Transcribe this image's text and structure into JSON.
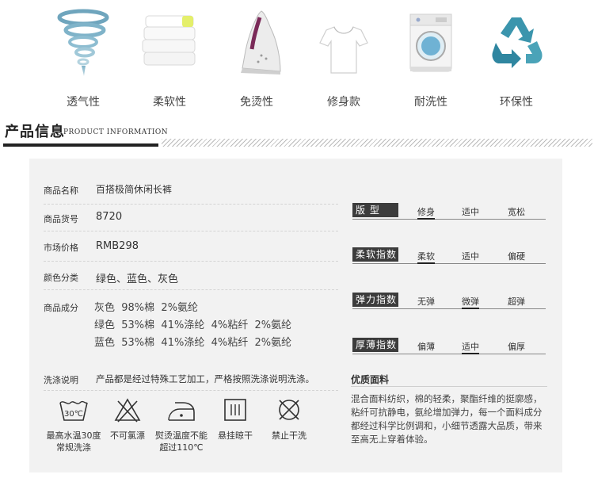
{
  "features": [
    {
      "icon": "tornado-icon",
      "label": "透气性"
    },
    {
      "icon": "folded-towels-icon",
      "label": "柔软性"
    },
    {
      "icon": "iron-icon",
      "label": "免烫性"
    },
    {
      "icon": "tshirt-icon",
      "label": "修身款"
    },
    {
      "icon": "washing-machine-icon",
      "label": "耐洗性"
    },
    {
      "icon": "recycle-icon",
      "label": "环保性"
    }
  ],
  "section": {
    "title": "产品信息",
    "subtitle": "PRODUCT INFORMATION"
  },
  "info": {
    "name": {
      "key": "商品名称",
      "value": "百搭极简休闲长裤"
    },
    "sku": {
      "key": "商品货号",
      "value": "8720"
    },
    "price": {
      "key": "市场价格",
      "value": "RMB298"
    },
    "colors": {
      "key": "颜色分类",
      "value": "绿色、蓝色、灰色"
    },
    "composition": {
      "key": "商品成分",
      "lines": [
        "灰色  98%棉  2%氨纶",
        "绿色  53%棉  41%涤纶  4%粘纤  2%氨纶",
        "蓝色  53%棉  41%涤纶  4%粘纤  2%氨纶"
      ]
    }
  },
  "scales": [
    {
      "label": "版    型",
      "options": [
        "修身",
        "适中",
        "宽松"
      ],
      "selected_index": 0
    },
    {
      "label": "柔软指数",
      "options": [
        "柔软",
        "适中",
        "偏硬"
      ],
      "selected_index": 0
    },
    {
      "label": "弹力指数",
      "options": [
        "无弹",
        "微弹",
        "超弹"
      ],
      "selected_index": 1
    },
    {
      "label": "厚薄指数",
      "options": [
        "偏薄",
        "适中",
        "偏厚"
      ],
      "selected_index": 1
    }
  ],
  "quality": {
    "title": "优质面料",
    "text": "混合面料纺织，棉的轻柔，聚酯纤维的挺廓感，粘纤可抗静电，氨纶增加弹力，每一个面料成分都经过科学比例调和，小细节透露大品质，带来至高无上穿着体验。"
  },
  "care": {
    "key": "洗涤说明",
    "value": "产品都是经过特殊工艺加工，严格按照洗涤说明洗涤。",
    "wash_temp": "30℃",
    "items": [
      {
        "icon": "wash-30-icon",
        "label_lines": [
          "最高水温30度",
          "常规洗涤"
        ]
      },
      {
        "icon": "no-bleach-icon",
        "label_lines": [
          "不可氯漂"
        ]
      },
      {
        "icon": "iron-temp-icon",
        "label_lines": [
          "熨烫温度不能",
          "超过110℃"
        ]
      },
      {
        "icon": "hang-dry-icon",
        "label_lines": [
          "悬挂晾干"
        ]
      },
      {
        "icon": "no-dry-clean-icon",
        "label_lines": [
          "禁止干洗"
        ]
      }
    ]
  }
}
